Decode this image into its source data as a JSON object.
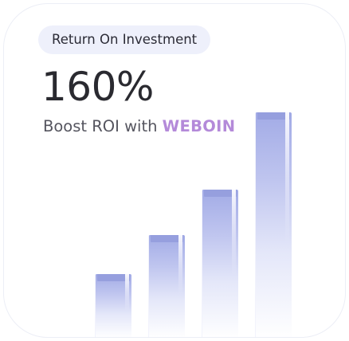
{
  "card": {
    "pill_label": "Return On Investment",
    "big_value": "160%",
    "subtitle_prefix": "Boost ROI with ",
    "subtitle_brand": "WEBOIN",
    "colors": {
      "pill_background": "#eef0fb",
      "brand_text": "#b48ad9",
      "bar_top": "#969fde",
      "text_dark": "#2a2a30"
    }
  },
  "chart_data": {
    "type": "bar",
    "categories": [
      "",
      "",
      "",
      ""
    ],
    "values": [
      1,
      1.6,
      2.3,
      3.5
    ],
    "ylim": [
      0,
      3.5
    ],
    "grid": false,
    "legend": "none"
  }
}
